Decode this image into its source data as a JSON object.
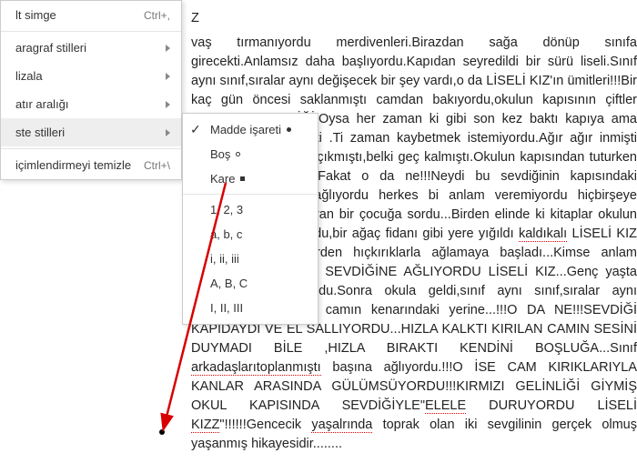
{
  "menu": {
    "items": [
      {
        "label": "lt simge",
        "shortcut": "Ctrl+,",
        "arrow": false
      },
      {
        "sep": true
      },
      {
        "label": "aragraf stilleri",
        "arrow": true
      },
      {
        "label": "lizala",
        "arrow": true
      },
      {
        "label": "atır aralığı",
        "arrow": true
      },
      {
        "label": "ste stilleri",
        "arrow": true,
        "highlighted": true
      },
      {
        "sep": true
      },
      {
        "label": "içimlendirmeyi temizle",
        "shortcut": "Ctrl+\\"
      }
    ]
  },
  "submenu": {
    "items": [
      {
        "label": "Madde işareti",
        "checked": true,
        "bullet": "dot"
      },
      {
        "label": "Boş",
        "bullet": "circle"
      },
      {
        "label": "Kare",
        "bullet": "square"
      },
      {
        "sep": true
      },
      {
        "label": "1, 2, 3"
      },
      {
        "label": "a, b, c"
      },
      {
        "label": "i, ii, iii"
      },
      {
        "label": "A, B, C"
      },
      {
        "label": "I, II, III"
      }
    ]
  },
  "document": {
    "line_z": "Z",
    "text": "vaş tırmanıyordu merdivenleri.Birazdan sağa dönüp sınıfa girecekti.Anlamsız daha başlıyordu.Kapıdan seyredildi bir sürü liseli.Sınıf aynı sınıf,sıralar aynı değişecek bir şey vardı,o da LİSELİ KIZ'ın ümitleri!!!Bir kaç gün öncesi saklanmıştı camdan bakıyordu,okulun kapısının çiftler gelmemişti SEVDİĞİ.Oysa her zaman ki gibi son kez baktı kapıya ama boşunaydı gelmemişti .Ti zaman kaybetmek istemiyordu.Ağır ağır inmişti merdivenleri belki işi çıkmıştı,belki geç kalmıştı.Okulun kapısından tuturken mahalleye gelmişti...Fakat o da ne!!!Neydi bu sevdiğinin kapısındaki kalabalık...!!!Neden ağlıyordu herkes bi anlam veremiyordu hiçbirşeye anlamadı yolda ağlayan bir çocuğa sordu...Birden elinde ki kitaplar okulun duvarından kararıyordu,bir ağaç fidanı gibi yere yığıldı kaldıkalı LİSELİ KIZ oracıkta,bilmiyordu,birden hıçkırıklarla ağlamaya başladı...Kimse anlam veremiyordu olanlara  SEVDİĞİNE  AĞLIYORDU  LİSELİ  KIZ...Genç  yaşta toprak olmuştu,yerindu.Sonra okula geldi,sınıf aynı sınıf,sıralar aynı sıralar...Geçti oturdu camın kenarındaki yerine...!!!O DA NE!!!SEVDİĞİ KAPIDAYDI VE EL SALLIYORDU...HIZLA KALKTI KIRILAN CAMIN SESİNİ DUYMADI BİLE ,HIZLA BIRAKTI KENDİNİ BOŞLUĞA...Sınıf arkadaşlarıtoplanmıştı başına ağlıyordu.!!!O İSE CAM KIRIKLARIYLA KANLAR ARASINDA GÜLÜMSÜYORDU!!!KIRMIZI GELİNLİĞİ GİYMİŞ OKUL KAPISINDA SEVDİĞİYLE\"ELELE DURUYORDU LİSELİ KIZZ\"!!!!!!Gencecik yaşalrında toprak olan iki sevgilinin gerçek olmuş yaşanmış hikayesidir........"
  }
}
